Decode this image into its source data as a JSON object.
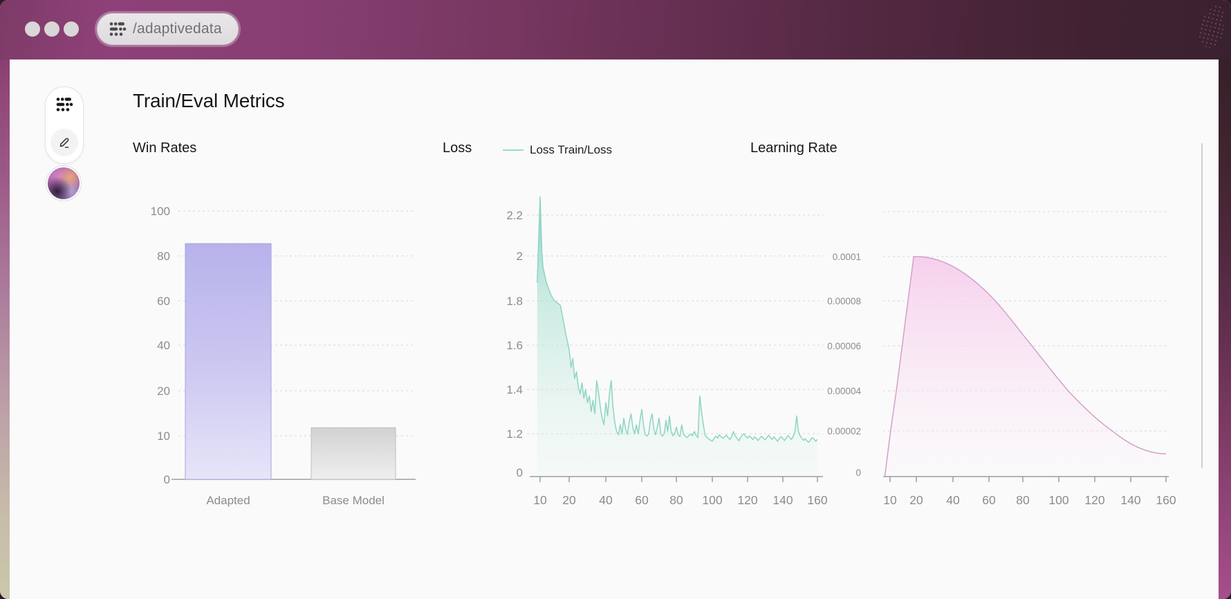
{
  "titlebar": {
    "url": "/adaptivedata",
    "traffic_lights": [
      "close",
      "minimize",
      "zoom"
    ]
  },
  "page": {
    "title": "Train/Eval Metrics"
  },
  "colors": {
    "frame_magenta": "#8e4179",
    "frame_maroon": "#3a2130",
    "bar_purple": "#b7b2eb",
    "loss_teal": "#8cd5c4",
    "lr_pink": "#f6cdec",
    "grid": "#d7d7d7",
    "axis": "#9e9e9e",
    "tick_text": "#8c8c8c"
  },
  "chart_data": {
    "win_rates": {
      "type": "bar",
      "title": "Win Rates",
      "categories": [
        "Adapted",
        "Base Model"
      ],
      "values": [
        85.5,
        11.8
      ],
      "y_ticks": [
        100,
        80,
        60,
        40,
        20,
        10,
        0
      ],
      "ylim": [
        0,
        100
      ],
      "grid": true,
      "bar_colors": [
        "purple",
        "gray"
      ]
    },
    "loss": {
      "type": "area",
      "title": "Loss",
      "legend": "Loss Train/Loss",
      "y_ticks": [
        2.2,
        2,
        1.8,
        1.6,
        1.4,
        1.2,
        0
      ],
      "x_ticks": [
        10,
        20,
        40,
        60,
        80,
        100,
        120,
        140,
        160
      ],
      "grid": true,
      "series": [
        {
          "name": "Loss Train/Loss",
          "points": [
            [
              9,
              1.88
            ],
            [
              10,
              2.29
            ],
            [
              10.6,
              2.02
            ],
            [
              11,
              1.95
            ],
            [
              12,
              1.89
            ],
            [
              13,
              1.85
            ],
            [
              14,
              1.82
            ],
            [
              15,
              1.8
            ],
            [
              16,
              1.79
            ],
            [
              17,
              1.78
            ],
            [
              18,
              1.71
            ],
            [
              19,
              1.64
            ],
            [
              20,
              1.58
            ],
            [
              21,
              1.5
            ],
            [
              22,
              1.54
            ],
            [
              23,
              1.45
            ],
            [
              24,
              1.48
            ],
            [
              25,
              1.41
            ],
            [
              26,
              1.38
            ],
            [
              27,
              1.43
            ],
            [
              28,
              1.36
            ],
            [
              29,
              1.4
            ],
            [
              30,
              1.34
            ],
            [
              31,
              1.37
            ],
            [
              32,
              1.3
            ],
            [
              33,
              1.35
            ],
            [
              34,
              1.29
            ],
            [
              35,
              1.44
            ],
            [
              36,
              1.39
            ],
            [
              37,
              1.32
            ],
            [
              38,
              1.27
            ],
            [
              39,
              1.24
            ],
            [
              40,
              1.34
            ],
            [
              41,
              1.28
            ],
            [
              42,
              1.38
            ],
            [
              43,
              1.44
            ],
            [
              44,
              1.32
            ],
            [
              45,
              1.25
            ],
            [
              46,
              1.21
            ],
            [
              47,
              1.17
            ],
            [
              48,
              1.24
            ],
            [
              49,
              1.19
            ],
            [
              50,
              1.27
            ],
            [
              51,
              1.22
            ],
            [
              52,
              1.18
            ],
            [
              53,
              1.25
            ],
            [
              54,
              1.29
            ],
            [
              55,
              1.23
            ],
            [
              56,
              1.19
            ],
            [
              57,
              1.24
            ],
            [
              58,
              1.2
            ],
            [
              59,
              1.26
            ],
            [
              60,
              1.31
            ],
            [
              61,
              1.24
            ],
            [
              62,
              1.18
            ],
            [
              63,
              1.13
            ],
            [
              64,
              1.2
            ],
            [
              65,
              1.26
            ],
            [
              66,
              1.29
            ],
            [
              67,
              1.22
            ],
            [
              68,
              1.17
            ],
            [
              69,
              1.23
            ],
            [
              70,
              1.27
            ],
            [
              71,
              1.19
            ],
            [
              72,
              1.13
            ],
            [
              73,
              1.2
            ],
            [
              74,
              1.26
            ],
            [
              75,
              1.21
            ],
            [
              76,
              1.28
            ],
            [
              77,
              1.21
            ],
            [
              78,
              1.14
            ],
            [
              79,
              1.19
            ],
            [
              80,
              1.23
            ],
            [
              81,
              1.17
            ],
            [
              82,
              1.12
            ],
            [
              83,
              1.24
            ],
            [
              84,
              1.19
            ],
            [
              85,
              1.13
            ],
            [
              86,
              1.09
            ],
            [
              87,
              1.15
            ],
            [
              88,
              1.19
            ],
            [
              89,
              1.14
            ],
            [
              90,
              1.21
            ],
            [
              91,
              1.15
            ],
            [
              92,
              1.09
            ],
            [
              93,
              1.37
            ],
            [
              94,
              1.3
            ],
            [
              95,
              1.24
            ],
            [
              96,
              1.16
            ],
            [
              97,
              1.1
            ],
            [
              98,
              1.05
            ],
            [
              99,
              1.02
            ],
            [
              100,
              0.99
            ],
            [
              101,
              1.07
            ],
            [
              102,
              1.13
            ],
            [
              103,
              1.08
            ],
            [
              104,
              1.17
            ],
            [
              105,
              1.11
            ],
            [
              106,
              1.07
            ],
            [
              107,
              1.12
            ],
            [
              108,
              1.16
            ],
            [
              109,
              1.09
            ],
            [
              110,
              1.04
            ],
            [
              111,
              1.12
            ],
            [
              112,
              1.21
            ],
            [
              113,
              1.14
            ],
            [
              114,
              1.07
            ],
            [
              115,
              1.0
            ],
            [
              116,
              1.09
            ],
            [
              117,
              1.16
            ],
            [
              118,
              1.2
            ],
            [
              119,
              1.12
            ],
            [
              120,
              1.08
            ],
            [
              121,
              1.14
            ],
            [
              122,
              1.09
            ],
            [
              123,
              1.04
            ],
            [
              124,
              1.11
            ],
            [
              125,
              1.06
            ],
            [
              126,
              1.01
            ],
            [
              127,
              1.08
            ],
            [
              128,
              1.13
            ],
            [
              129,
              1.07
            ],
            [
              130,
              1.03
            ],
            [
              131,
              1.1
            ],
            [
              132,
              1.16
            ],
            [
              133,
              1.09
            ],
            [
              134,
              1.04
            ],
            [
              135,
              1.11
            ],
            [
              136,
              1.05
            ],
            [
              137,
              0.99
            ],
            [
              138,
              1.07
            ],
            [
              139,
              1.12
            ],
            [
              140,
              1.06
            ],
            [
              141,
              1.01
            ],
            [
              142,
              1.09
            ],
            [
              143,
              1.15
            ],
            [
              144,
              1.09
            ],
            [
              145,
              1.04
            ],
            [
              146,
              1.13
            ],
            [
              147,
              1.21
            ],
            [
              148,
              1.28
            ],
            [
              149,
              1.21
            ],
            [
              150,
              1.14
            ],
            [
              151,
              1.07
            ],
            [
              152,
              1.01
            ],
            [
              153,
              1.06
            ],
            [
              154,
              0.99
            ],
            [
              155,
              0.96
            ],
            [
              156,
              1.03
            ],
            [
              157,
              1.09
            ],
            [
              158,
              1.05
            ],
            [
              159,
              0.99
            ],
            [
              160,
              1.04
            ]
          ]
        }
      ]
    },
    "learning_rate": {
      "type": "area",
      "title": "Learning Rate",
      "y_tick_labels": [
        "0.0001",
        "0.00008",
        "0.00006",
        "0.00004",
        "0.00002",
        "0"
      ],
      "y_tick_values": [
        0.0001,
        8e-05,
        6e-05,
        4e-05,
        2e-05,
        0
      ],
      "x_ticks": [
        10,
        20,
        40,
        60,
        80,
        100,
        120,
        140,
        160
      ],
      "grid": true,
      "schedule": {
        "shape": "linear-warmup-then-cosine-decay",
        "start_step": 8,
        "warmup_end_step": 19,
        "peak_lr": 0.0001,
        "end_step": 160,
        "final_lr": 1e-05
      }
    }
  }
}
